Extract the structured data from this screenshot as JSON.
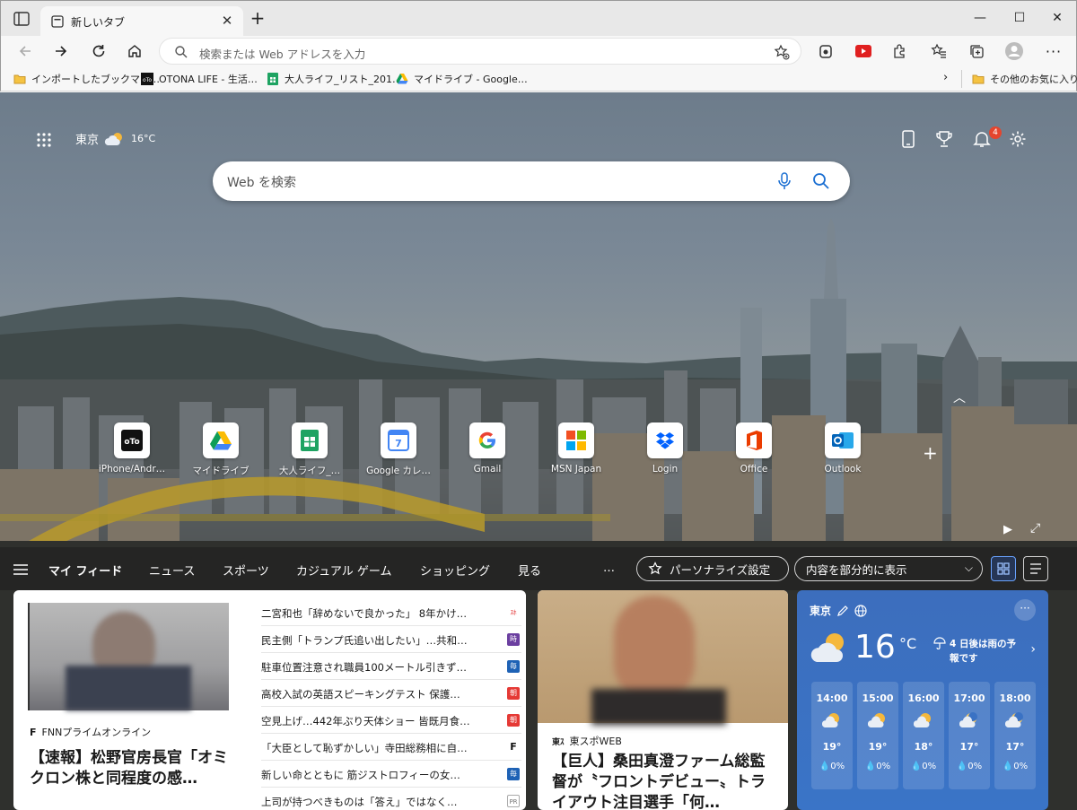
{
  "tab": {
    "title": "新しいタブ"
  },
  "address": {
    "placeholder": "検索または Web アドレスを入力"
  },
  "bookmarks": [
    {
      "label": "インポートしたブックマー…",
      "icon": "folder-icon"
    },
    {
      "label": "OTONA LIFE - 生活…",
      "icon": "otona-icon"
    },
    {
      "label": "大人ライフ_リスト_201…",
      "icon": "sheets-icon"
    },
    {
      "label": "マイドライブ - Google…",
      "icon": "drive-icon"
    }
  ],
  "bookmarks_other": "その他のお気に入り",
  "top": {
    "city": "東京",
    "temp": "16°C",
    "notification_count": "4"
  },
  "search": {
    "placeholder": "Web を検索"
  },
  "quick_links": [
    {
      "label": "iPhone/Andr…"
    },
    {
      "label": "マイドライブ"
    },
    {
      "label": "大人ライフ_…"
    },
    {
      "label": "Google カレ…"
    },
    {
      "label": "Gmail"
    },
    {
      "label": "MSN Japan"
    },
    {
      "label": "Login"
    },
    {
      "label": "Office"
    },
    {
      "label": "Outlook"
    }
  ],
  "feed_nav": {
    "items": [
      "マイ フィード",
      "ニュース",
      "スポーツ",
      "カジュアル ゲーム",
      "ショッピング",
      "見る"
    ],
    "more": "…",
    "personalize": "パーソナライズ設定",
    "content_select": "内容を部分的に表示"
  },
  "card1": {
    "source": "FNNプライムオンライン",
    "headline": "【速報】松野官房長官「オミクロン株と同程度の感…",
    "list": [
      {
        "text": "二宮和也「辞めないで良かった」 8年かけ…",
        "badge": "sponichi"
      },
      {
        "text": "民主側「トランプ氏追い出したい」…共和…",
        "badge": "jiji"
      },
      {
        "text": "駐車位置注意され職員100メートル引きず…",
        "badge": "mainichi"
      },
      {
        "text": "高校入試の英語スピーキングテスト 保護…",
        "badge": "tvasahi"
      },
      {
        "text": "空見上げ…442年ぶり天体ショー 皆既月食…",
        "badge": "tvasahi"
      },
      {
        "text": "「大臣として恥ずかしい」寺田総務相に自…",
        "badge": "fnn"
      },
      {
        "text": "新しい命とともに 筋ジストロフィーの女…",
        "badge": "mainichi"
      },
      {
        "text": "上司が持つべきものは「答え」ではなく…",
        "badge": "pr"
      }
    ]
  },
  "card2": {
    "source": "東スポWEB",
    "headline": "【巨人】桑田真澄ファーム総監督が〝フロントデビュー〟トライアウト注目選手「何…"
  },
  "weather": {
    "city": "東京",
    "temp": "16",
    "unit": "°C",
    "forecast": "4 日後は雨の予報です",
    "hours": [
      {
        "time": "14:00",
        "temp": "19°",
        "precip": "0%",
        "icon": "partly-sunny-icon"
      },
      {
        "time": "15:00",
        "temp": "19°",
        "precip": "0%",
        "icon": "partly-sunny-icon"
      },
      {
        "time": "16:00",
        "temp": "18°",
        "precip": "0%",
        "icon": "partly-sunny-icon"
      },
      {
        "time": "17:00",
        "temp": "17°",
        "precip": "0%",
        "icon": "partly-cloudy-night-icon"
      },
      {
        "time": "18:00",
        "temp": "17°",
        "precip": "0%",
        "icon": "partly-cloudy-night-icon"
      }
    ]
  }
}
